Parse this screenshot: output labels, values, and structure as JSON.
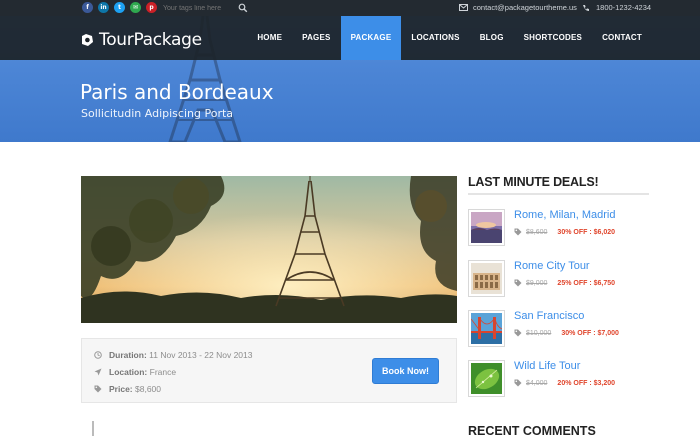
{
  "topbar": {
    "social": [
      {
        "icon": "facebook-icon",
        "glyph": "f",
        "color": "#3b5998"
      },
      {
        "icon": "linkedin-icon",
        "glyph": "in",
        "color": "#0e76a8"
      },
      {
        "icon": "twitter-icon",
        "glyph": "t",
        "color": "#1da1f2"
      },
      {
        "icon": "email-icon",
        "glyph": "✉",
        "color": "#2fa84f"
      },
      {
        "icon": "pinterest-icon",
        "glyph": "p",
        "color": "#cb2027"
      }
    ],
    "search_placeholder": "Your tags line here",
    "email": "contact@packagetourtheme.us",
    "phone": "1800-1232-4234"
  },
  "header": {
    "logo_text": "TourPackage",
    "nav": [
      {
        "label": "HOME",
        "active": false
      },
      {
        "label": "PAGES",
        "active": false
      },
      {
        "label": "PACKAGE",
        "active": true
      },
      {
        "label": "LOCATIONS",
        "active": false
      },
      {
        "label": "BLOG",
        "active": false
      },
      {
        "label": "SHORTCODES",
        "active": false
      },
      {
        "label": "CONTACT",
        "active": false
      }
    ]
  },
  "hero": {
    "title": "Paris and Bordeaux",
    "subtitle": "Sollicitudin Adipiscing Porta"
  },
  "tour": {
    "duration_label": "Duration:",
    "duration_value": "11 Nov 2013 - 22 Nov 2013",
    "location_label": "Location:",
    "location_value": "France",
    "price_label": "Price:",
    "price_value": "$8,600",
    "book_label": "Book Now!"
  },
  "sidebar": {
    "deals_title": "LAST MINUTE DEALS!",
    "deals": [
      {
        "name": "Rome, Milan, Madrid",
        "old_price": "$8,600",
        "offer": "30% OFF : $6,020",
        "thumb": "sunset-lake"
      },
      {
        "name": "Rome City Tour",
        "old_price": "$9,000",
        "offer": "25% OFF : $6,750",
        "thumb": "colosseum"
      },
      {
        "name": "San Francisco",
        "old_price": "$10,000",
        "offer": "30% OFF : $7,000",
        "thumb": "golden-gate"
      },
      {
        "name": "Wild Life Tour",
        "old_price": "$4,000",
        "offer": "20% OFF : $3,200",
        "thumb": "green-leaf"
      }
    ],
    "comments_title": "RECENT COMMENTS"
  },
  "colors": {
    "accent": "#3d8ee8",
    "offer": "#e0452c",
    "topbar": "#232a31"
  }
}
